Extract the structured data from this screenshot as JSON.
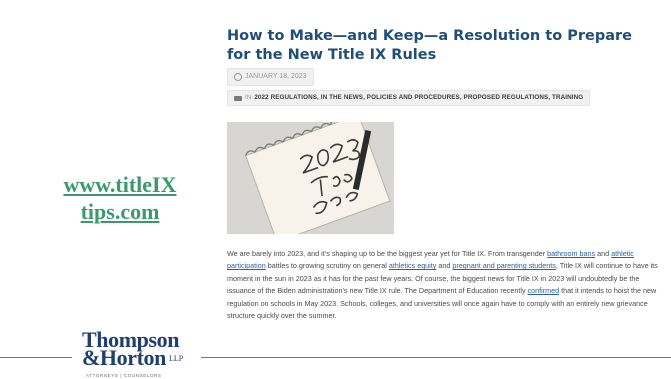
{
  "site_link": {
    "line1": "www.titleIX",
    "line2": "tips.com"
  },
  "article": {
    "title": "How to Make—and Keep—a Resolution to Prepare for the New Title IX Rules",
    "date": "JANUARY 18, 2023",
    "categories_prefix": "IN",
    "categories": "2022 REGULATIONS, IN THE NEWS, POLICIES AND PROCEDURES, PROPOSED REGULATIONS, TRAINING",
    "body": {
      "p1": "We are barely into 2023, and it’s shaping up to be the biggest year yet for Title IX. From transgender ",
      "link_bathroom": "bathroom bans",
      "p2": " and ",
      "link_athletic": "athletic participation",
      "p3": " battles to growing scrutiny on general ",
      "link_equity": "athletics equity",
      "p4": " and ",
      "link_pregnant": "pregnant and parenting students",
      "p5": ", Title IX will continue to have its moment in the sun in 2023 as it has for the past few years. Of course, the biggest news for Title IX in 2023 will undoubtedly be the issuance of the Biden administration’s new Title IX rule. The Department of Education recently ",
      "link_confirmed": "confirmed",
      "p6": " that it intends to hoist the new regulation on schools in May 2023. Schools, colleges, and universities will once again have to comply with an entirely new grievance structure quickly over the summer."
    }
  },
  "logo": {
    "line1": "Thompson",
    "line2": "&Horton",
    "suffix": "LLP",
    "tagline": "ATTORNEYS | COUNSELORS"
  },
  "colors": {
    "link_green": "#3a9a6e",
    "title_blue": "#1f4e79",
    "rule_blue": "#4d7eb3"
  }
}
